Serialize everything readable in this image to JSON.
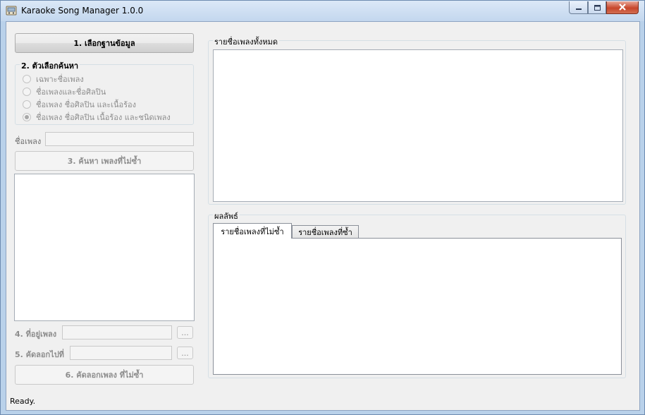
{
  "window": {
    "title": "Karaoke Song Manager  1.0.0"
  },
  "left_panel": {
    "select_db_button": "1. เลือกฐานข้อมูล",
    "search_options": {
      "title": "2. ตัวเลือกค้นหา",
      "options": [
        {
          "label": "เฉพาะชื่อเพลง",
          "checked": false
        },
        {
          "label": "ชื่อเพลงและชื่อศิลปิน",
          "checked": false
        },
        {
          "label": "ชื่อเพลง ชื่อศิลปิน และเนื้อร้อง",
          "checked": false
        },
        {
          "label": "ชื่อเพลง ชื่อศิลปิน เนื้อร้อง และชนิดเพลง",
          "checked": true
        }
      ]
    },
    "song_name_label": "ชื่อเพลง",
    "song_name_value": "",
    "find_unique_button": "3. ค้นหา เพลงที่ไม่ซ้ำ",
    "location_label": "4. ที่อยู่เพลง",
    "location_value": "",
    "location_browse": "...",
    "copy_to_label": "5. คัดลอกไปที่",
    "copy_to_value": "",
    "copy_to_browse": "...",
    "copy_unique_button": "6. คัดลอกเพลง ที่ไม่ซ้ำ"
  },
  "right_panel": {
    "all_songs_title": "รายชื่อเพลงทั้งหมด",
    "results_title": "ผลลัพธ์",
    "tabs": [
      {
        "label": "รายชื่อเพลงที่ไม่ซ้ำ",
        "active": true
      },
      {
        "label": "รายชื่อเพลงที่ซ้ำ",
        "active": false
      }
    ]
  },
  "status_bar": {
    "text": "Ready."
  }
}
